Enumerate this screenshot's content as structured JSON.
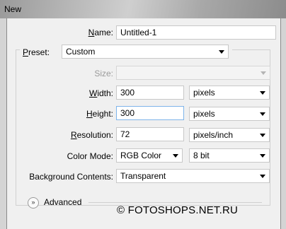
{
  "window": {
    "title": "New"
  },
  "name": {
    "label_u": "N",
    "label_rest": "ame:",
    "value": "Untitled-1"
  },
  "preset": {
    "label_u": "P",
    "label_rest": "reset:",
    "value": "Custom"
  },
  "size": {
    "label": "Size:",
    "value": ""
  },
  "width": {
    "label_u": "W",
    "label_rest": "idth:",
    "value": "300",
    "unit": "pixels"
  },
  "height": {
    "label_u": "H",
    "label_rest": "eight:",
    "value": "300",
    "unit": "pixels"
  },
  "resolution": {
    "label_u": "R",
    "label_rest": "esolution:",
    "value": "72",
    "unit": "pixels/inch"
  },
  "color_mode": {
    "label": "Color Mode:",
    "mode": "RGB Color",
    "depth": "8 bit"
  },
  "background": {
    "label": "Background Contents:",
    "value": "Transparent"
  },
  "advanced": {
    "icon": "double-chevron-down-icon",
    "label": "Advanced"
  },
  "watermark": {
    "text": "© FOTOSHOPS.NET.RU"
  },
  "colors": {
    "panel": "#f0f0f0",
    "focus_border": "#7eb4ea"
  }
}
